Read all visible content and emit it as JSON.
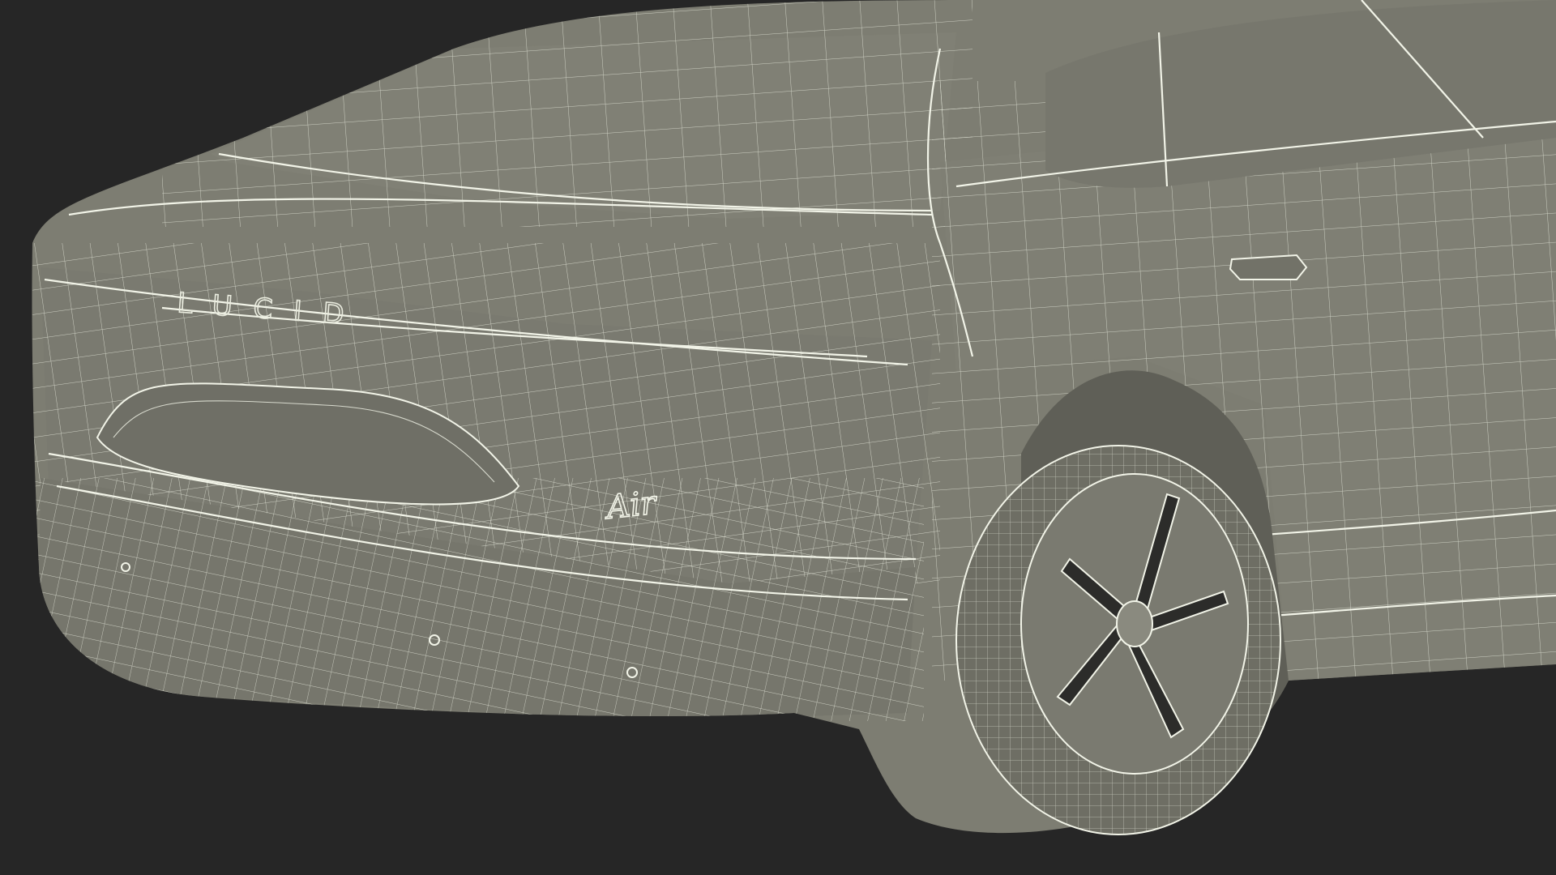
{
  "scene": {
    "subject": "car-rear-wireframe",
    "background_color": "#262626",
    "surface_color": "#7d7d72",
    "surface_shade_color": "#6a6a60",
    "wire_color": "#e9ebde"
  },
  "badges": {
    "brand_lettering": "LUCID",
    "model_script": "Air"
  }
}
